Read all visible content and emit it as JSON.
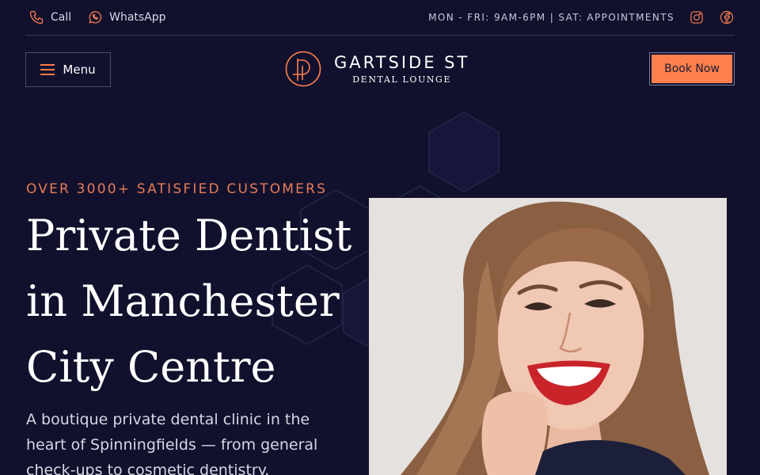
{
  "topbar": {
    "call_label": "Call",
    "whatsapp_label": "WhatsApp",
    "hours": "MON - FRI: 9AM-6PM | SAT: APPOINTMENTS",
    "social": [
      "instagram-icon",
      "facebook-icon"
    ]
  },
  "nav": {
    "menu_label": "Menu",
    "logo_name": "GARTSIDE ST",
    "logo_sub": "DENTAL LOUNGE",
    "book_label": "Book Now"
  },
  "hero": {
    "eyebrow": "OVER 3000+ SATISFIED CUSTOMERS",
    "headline_1": "Private Dentist",
    "headline_2": "in Manchester",
    "headline_3": "City Centre",
    "lede": "A boutique private dental clinic in the heart of Spinningfields — from general check-ups to cosmetic dentistry."
  },
  "colors": {
    "background": "#11112e",
    "accent": "#ff7f4d",
    "eyebrow": "#e87b55"
  }
}
